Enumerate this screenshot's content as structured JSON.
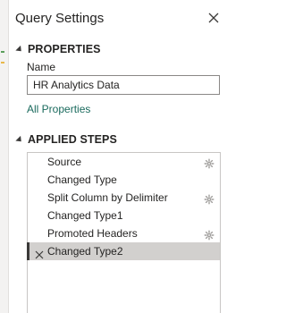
{
  "panel": {
    "title": "Query Settings"
  },
  "properties": {
    "header": "PROPERTIES",
    "name_label": "Name",
    "name_value": "HR Analytics Data",
    "all_properties_link": "All Properties"
  },
  "applied_steps": {
    "header": "APPLIED STEPS",
    "steps": [
      {
        "label": "Source",
        "has_settings": true,
        "selected": false
      },
      {
        "label": "Changed Type",
        "has_settings": false,
        "selected": false
      },
      {
        "label": "Split Column by Delimiter",
        "has_settings": true,
        "selected": false
      },
      {
        "label": "Changed Type1",
        "has_settings": false,
        "selected": false
      },
      {
        "label": "Promoted Headers",
        "has_settings": true,
        "selected": false
      },
      {
        "label": "Changed Type2",
        "has_settings": false,
        "selected": true
      }
    ]
  },
  "icons": {
    "close": "close-icon",
    "collapse": "collapse-triangle-icon",
    "settings": "gear-icon",
    "delete_step": "delete-step-icon"
  },
  "colors": {
    "link": "#1a6a5d",
    "selected_row": "#d2d0ce",
    "selected_bar": "#3b3a39"
  }
}
